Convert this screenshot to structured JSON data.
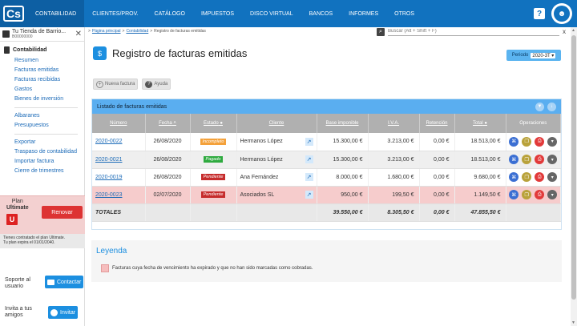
{
  "topnav": {
    "logo": "Cs",
    "menu": [
      "CONTABILIDAD",
      "CLIENTES/PROV.",
      "CATÁLOGO",
      "IMPUESTOS",
      "DISCO VIRTUAL",
      "BANCOS",
      "INFORMES",
      "OTROS"
    ],
    "help": "?"
  },
  "company": {
    "name": "Tu Tienda de Barrio...",
    "id": "B00000000"
  },
  "sidebar": {
    "section_title": "Contabilidad",
    "group1": [
      "Resumen",
      "Facturas emitidas",
      "Facturas recibidas",
      "Gastos",
      "Bienes de inversión"
    ],
    "group2": [
      "Albaranes",
      "Presupuestos"
    ],
    "group3": [
      "Exportar",
      "Traspaso de contabilidad",
      "Importar factura",
      "Cierre de trimestres"
    ]
  },
  "plan": {
    "label_line1": "Plan",
    "label_line2": "Ultimate",
    "badge": "U",
    "renew_label": "Renovar",
    "note_line1": "Tienes contratado el plan Ultimate.",
    "note_line2": "Tu plan expira el 01/01/2040."
  },
  "support": {
    "text_line1": "Soporte al",
    "text_line2": "usuario",
    "button": "Contactar"
  },
  "invite": {
    "text_line1": "Invita a tus",
    "text_line2": "amigos",
    "button": "Invitar"
  },
  "breadcrumb": {
    "home": "Página principal",
    "section": "Contabilidad",
    "current": "Registro de facturas emitidas",
    "separator": ">"
  },
  "search": {
    "placeholder": "Buscar (Alt + Shift + F)",
    "clear": "x"
  },
  "page": {
    "title": "Registro de facturas emitidas"
  },
  "period": {
    "label": "Periodo",
    "value": "2020-3T"
  },
  "actions": {
    "new_invoice": "Nueva factura",
    "help": "Ayuda"
  },
  "list": {
    "title": "Listado de facturas emitidas",
    "columns": [
      "Número",
      "Fecha",
      "Estado",
      "Cliente",
      "Base imponible",
      "I.V.A.",
      "Retención",
      "Total",
      "Operaciones"
    ],
    "rows": [
      {
        "numero": "2020-0022",
        "fecha": "26/08/2020",
        "estado": "Incompleto",
        "cliente": "Hermanos López",
        "base": "15.300,00 €",
        "iva": "3.213,00 €",
        "ret": "0,00 €",
        "total": "18.513,00 €"
      },
      {
        "numero": "2020-0021",
        "fecha": "26/08/2020",
        "estado": "Pagado",
        "cliente": "Hermanos López",
        "base": "15.300,00 €",
        "iva": "3.213,00 €",
        "ret": "0,00 €",
        "total": "18.513,00 €"
      },
      {
        "numero": "2020-0019",
        "fecha": "26/08/2020",
        "estado": "Pendiente",
        "cliente": "Ana Fernández",
        "base": "8.000,00 €",
        "iva": "1.680,00 €",
        "ret": "0,00 €",
        "total": "9.680,00 €"
      },
      {
        "numero": "2020-0023",
        "fecha": "02/07/2020",
        "estado": "Pendiente",
        "cliente": "Asociados SL",
        "base": "950,00 €",
        "iva": "199,50 €",
        "ret": "0,00 €",
        "total": "1.149,50 €"
      }
    ],
    "totals": {
      "label": "TOTALES",
      "base": "39.550,00 €",
      "iva": "8.305,50 €",
      "ret": "0,00 €",
      "total": "47.855,50 €"
    }
  },
  "legend": {
    "title": "Leyenda",
    "item": "Facturas cuya fecha de vencimiento ha expirado y que no han sido marcadas como cobradas."
  },
  "colors": {
    "primary": "#1172bf",
    "header": "#5aaef0",
    "incomplete": "#f4a13a",
    "paid": "#2eaa3f",
    "pending": "#c62c2c",
    "overdue_row": "#f6cccc"
  }
}
